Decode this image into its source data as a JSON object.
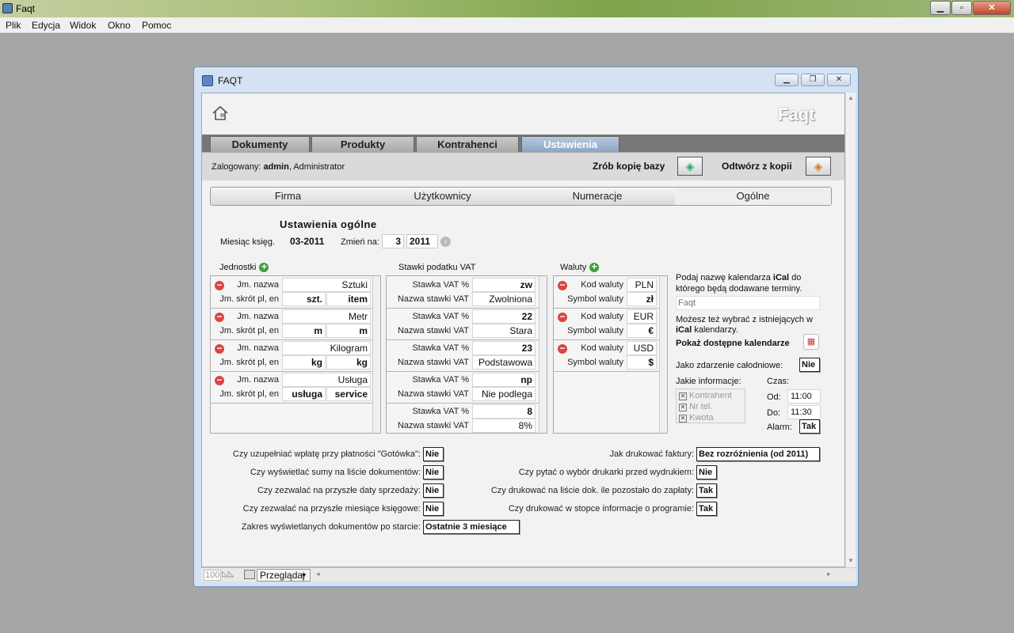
{
  "app": {
    "title": "Faqt"
  },
  "menu": [
    "Plik",
    "Edycja",
    "Widok",
    "Okno",
    "Pomoc"
  ],
  "window": {
    "title": "FAQT"
  },
  "logo": "Faqt",
  "tabs": [
    "Dokumenty",
    "Produkty",
    "Kontrahenci",
    "Ustawienia"
  ],
  "user": {
    "prefix": "Zalogowany:",
    "name": "admin",
    "role": ", Administrator"
  },
  "backup": {
    "make_label": "Zrób kopię bazy",
    "restore_label": "Odtwórz z kopii"
  },
  "subtabs": [
    "Firma",
    "Użytkownicy",
    "Numeracje",
    "Ogólne"
  ],
  "general": {
    "heading": "Ustawienia ogólne",
    "month_label": "Miesiąc księg.",
    "month_value": "03-2011",
    "change_label": "Zmień na:",
    "change_month": "3",
    "change_year": "2011"
  },
  "units": {
    "title": "Jednostki",
    "name_label": "Jm. nazwa",
    "short_label": "Jm. skrót pl, en",
    "items": [
      {
        "name": "Sztuki",
        "pl": "szt.",
        "en": "item"
      },
      {
        "name": "Metr",
        "pl": "m",
        "en": "m"
      },
      {
        "name": "Kilogram",
        "pl": "kg",
        "en": "kg"
      },
      {
        "name": "Usługa",
        "pl": "usługa",
        "en": "service"
      }
    ]
  },
  "vat": {
    "title": "Stawki podatku VAT",
    "rate_label": "Stawka VAT %",
    "name_label": "Nazwa stawki VAT",
    "items": [
      {
        "rate": "zw",
        "name": "Zwolniona"
      },
      {
        "rate": "22",
        "name": "Stara"
      },
      {
        "rate": "23",
        "name": "Podstawowa"
      },
      {
        "rate": "np",
        "name": "Nie podlega"
      },
      {
        "rate": "8",
        "name": "8%"
      }
    ]
  },
  "currencies": {
    "title": "Waluty",
    "code_label": "Kod waluty",
    "symbol_label": "Symbol waluty",
    "items": [
      {
        "code": "PLN",
        "symbol": "zł"
      },
      {
        "code": "EUR",
        "symbol": "€"
      },
      {
        "code": "USD",
        "symbol": "$"
      }
    ]
  },
  "ical": {
    "desc1_a": "Podaj nazwę kalendarza ",
    "desc1_b": "iCal",
    "desc1_c": " do",
    "desc1_line2": "którego będą dodawane terminy.",
    "input_placeholder": "Faqt",
    "desc2_line1": "Możesz też wybrać z istniejących w",
    "desc2_b": "iCal",
    "desc2_c": " kalendarzy.",
    "show_label": "Pokaż dostępne kalendarze",
    "allday_label": "Jako zdarzenie całodniowe:",
    "allday_value": "Nie",
    "info_label": "Jakie informacje:",
    "info_items": [
      "Kontrahent",
      "Nr tel.",
      "Kwota"
    ],
    "time_label": "Czas:",
    "from_label": "Od:",
    "from_value": "11:00",
    "to_label": "Do:",
    "to_value": "11:30",
    "alarm_label": "Alarm:",
    "alarm_value": "Tak"
  },
  "questions_left": [
    {
      "label": "Czy uzupełniać wpłatę przy płatności \"Gotówka\":",
      "value": "Nie"
    },
    {
      "label": "Czy wyświetlać sumy na liście dokumentów:",
      "value": "Nie"
    },
    {
      "label": "Czy zezwalać na przyszłe daty sprzedaży:",
      "value": "Nie"
    },
    {
      "label": "Czy zezwalać na przyszłe miesiące księgowe:",
      "value": "Nie"
    },
    {
      "label": "Zakres wyświetlanych dokumentów po starcie:",
      "value": "Ostatnie 3 miesiące"
    }
  ],
  "questions_right": [
    {
      "label": "Jak drukować faktury:",
      "value": "Bez rozróżnienia (od 2011)"
    },
    {
      "label": "Czy pytać o wybór drukarki przed wydrukiem:",
      "value": "Nie"
    },
    {
      "label": "Czy drukować na liście dok. ile pozostało do zapłaty:",
      "value": "Tak"
    },
    {
      "label": "Czy drukować w stopce informacje o programie:",
      "value": "Tak"
    }
  ],
  "statusbar": {
    "zoom": "100",
    "mode": "Przeglądaj"
  }
}
